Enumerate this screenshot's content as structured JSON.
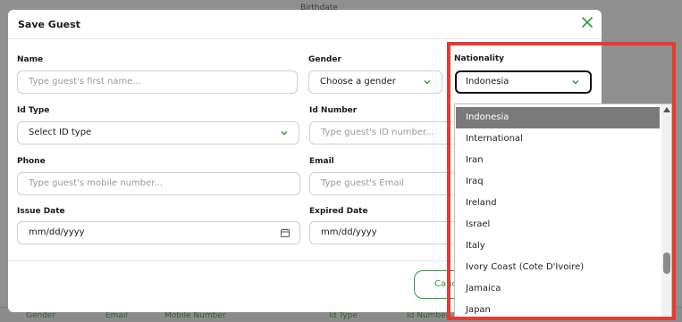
{
  "background": {
    "top_text": "Birthdate",
    "footer_columns": [
      "Gender",
      "Email",
      "Mobile Number",
      "Id Type",
      "Id Number"
    ]
  },
  "modal": {
    "title": "Save Guest",
    "close_icon": "close-x-icon",
    "name": {
      "label": "Name",
      "placeholder": "Type guest's first name..."
    },
    "gender": {
      "label": "Gender",
      "value": "Choose a gender"
    },
    "nationality": {
      "label": "Nationality",
      "value": "Indonesia"
    },
    "id_type": {
      "label": "Id Type",
      "value": "Select ID type"
    },
    "id_number": {
      "label": "Id Number",
      "placeholder": "Type guest's ID number..."
    },
    "phone": {
      "label": "Phone",
      "placeholder": "Type guest's mobile number..."
    },
    "email": {
      "label": "Email",
      "placeholder": "Type guest's Email"
    },
    "issue_date": {
      "label": "Issue Date",
      "value": "mm/dd/yyyy"
    },
    "expired_date": {
      "label": "Expired Date",
      "value": "mm/dd/yyyy"
    },
    "cancel_label": "Canc"
  },
  "dropdown": {
    "options": [
      "Indonesia",
      "International",
      "Iran",
      "Iraq",
      "Ireland",
      "Israel",
      "Italy",
      "Ivory Coast (Cote D'Ivoire)",
      "Jamaica",
      "Japan"
    ],
    "selected": "Indonesia"
  },
  "colors": {
    "accent": "#2e9a3a",
    "highlight": "#e53b33",
    "selected_option": "#7a7a7a"
  }
}
